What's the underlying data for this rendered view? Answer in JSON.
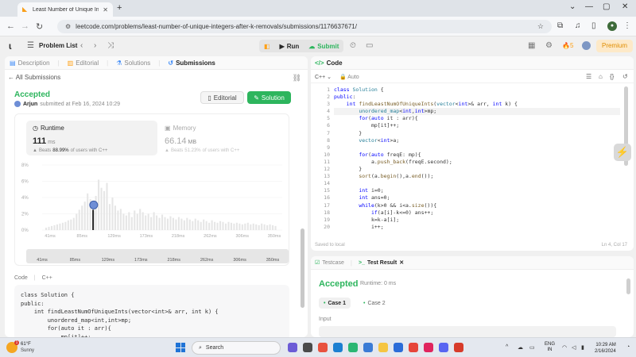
{
  "browser": {
    "tab_title": "Least Number of Unique Intege",
    "url": "leetcode.com/problems/least-number-of-unique-integers-after-k-removals/submissions/1176637671/"
  },
  "header": {
    "problem_list": "Problem List",
    "run": "Run",
    "submit": "Submit",
    "streak": "5",
    "premium": "Premium"
  },
  "left_tabs": [
    {
      "label": "Description"
    },
    {
      "label": "Editorial"
    },
    {
      "label": "Solutions"
    },
    {
      "label": "Submissions"
    }
  ],
  "submission": {
    "back_label": "All Submissions",
    "status": "Accepted",
    "user": "Arjun",
    "submitted_text": "submitted at Feb 16, 2024 10:29",
    "editorial_btn": "Editorial",
    "solution_btn": "Solution",
    "runtime_label": "Runtime",
    "runtime_value": "111",
    "runtime_unit": "ms",
    "runtime_beats_prefix": "Beats",
    "runtime_beats_pct": "88.99%",
    "runtime_beats_suffix": "of users with C++",
    "memory_label": "Memory",
    "memory_value": "66.14",
    "memory_unit": "MB",
    "memory_beats_prefix": "Beats",
    "memory_beats_pct": "51.23%",
    "memory_beats_suffix": "of users with C++",
    "code_label": "Code",
    "code_lang": "C++",
    "code_preview": "class Solution {\npublic:\n    int findLeastNumOfUniqueInts(vector<int>& arr, int k) {\n        unordered_map<int,int>mp;\n        for(auto it : arr){\n            mp[it]++;"
  },
  "chart_data": {
    "type": "bar",
    "y_ticks": [
      "8%",
      "6%",
      "4%",
      "2%",
      "0%"
    ],
    "ylim": [
      0,
      8
    ],
    "x_ticks": [
      "41ms",
      "85ms",
      "129ms",
      "173ms",
      "218ms",
      "262ms",
      "306ms",
      "350ms"
    ],
    "scrubber_ticks": [
      "41ms",
      "85ms",
      "129ms",
      "173ms",
      "218ms",
      "262ms",
      "306ms",
      "350ms"
    ],
    "highlight_index": 17,
    "values": [
      0.3,
      0.4,
      0.5,
      0.6,
      0.7,
      0.8,
      0.9,
      1.0,
      1.2,
      1.3,
      1.5,
      2.0,
      2.5,
      3.0,
      3.5,
      4.5,
      3.8,
      2.5,
      4.2,
      6.2,
      5.2,
      4.8,
      5.8,
      3.2,
      4.0,
      3.0,
      2.4,
      2.6,
      2.0,
      1.8,
      2.2,
      1.6,
      2.4,
      2.0,
      2.6,
      2.2,
      1.8,
      2.0,
      1.6,
      2.2,
      1.8,
      1.5,
      1.9,
      1.6,
      1.4,
      1.7,
      1.5,
      1.3,
      1.6,
      1.4,
      1.2,
      1.5,
      1.3,
      1.1,
      1.4,
      1.2,
      1.0,
      1.3,
      1.1,
      0.9,
      1.2,
      1.0,
      0.9,
      1.1,
      1.0,
      0.8,
      1.0,
      0.9,
      0.8,
      0.9,
      0.8,
      0.7,
      0.8,
      0.9,
      0.7,
      0.8,
      0.7,
      0.6,
      0.8,
      0.7,
      0.6,
      0.7,
      0.6,
      0.5
    ]
  },
  "editor": {
    "tab": "Code",
    "lang": "C++",
    "auto": "Auto",
    "saved": "Saved to local",
    "position": "Ln 4, Col 17",
    "lines": [
      "class Solution {",
      "public:",
      "    int findLeastNumOfUniqueInts(vector<int>& arr, int k) {",
      "        unordered_map<int,int>mp;",
      "        for(auto it : arr){",
      "            mp[it]++;",
      "        }",
      "        vector<int>a;",
      "",
      "        for(auto freqE: mp){",
      "            a.push_back(freqE.second);",
      "        }",
      "        sort(a.begin(),a.end());",
      "",
      "        int i=0;",
      "        int ans=0;",
      "        while(k>0 && i<a.size()){",
      "            if(a[i]-k<=0) ans++;",
      "            k=k-a[i];",
      "            i++;"
    ]
  },
  "test": {
    "tab_testcase": "Testcase",
    "tab_result": "Test Result",
    "status": "Accepted",
    "runtime": "Runtime: 0 ms",
    "case1": "Case 1",
    "case2": "Case 2",
    "input_label": "Input"
  },
  "taskbar": {
    "temp": "61°F",
    "condition": "Sunny",
    "search": "Search",
    "lang1": "ENG",
    "lang2": "IN",
    "time": "10:29 AM",
    "date": "2/16/2024",
    "weather_badge": "1"
  }
}
